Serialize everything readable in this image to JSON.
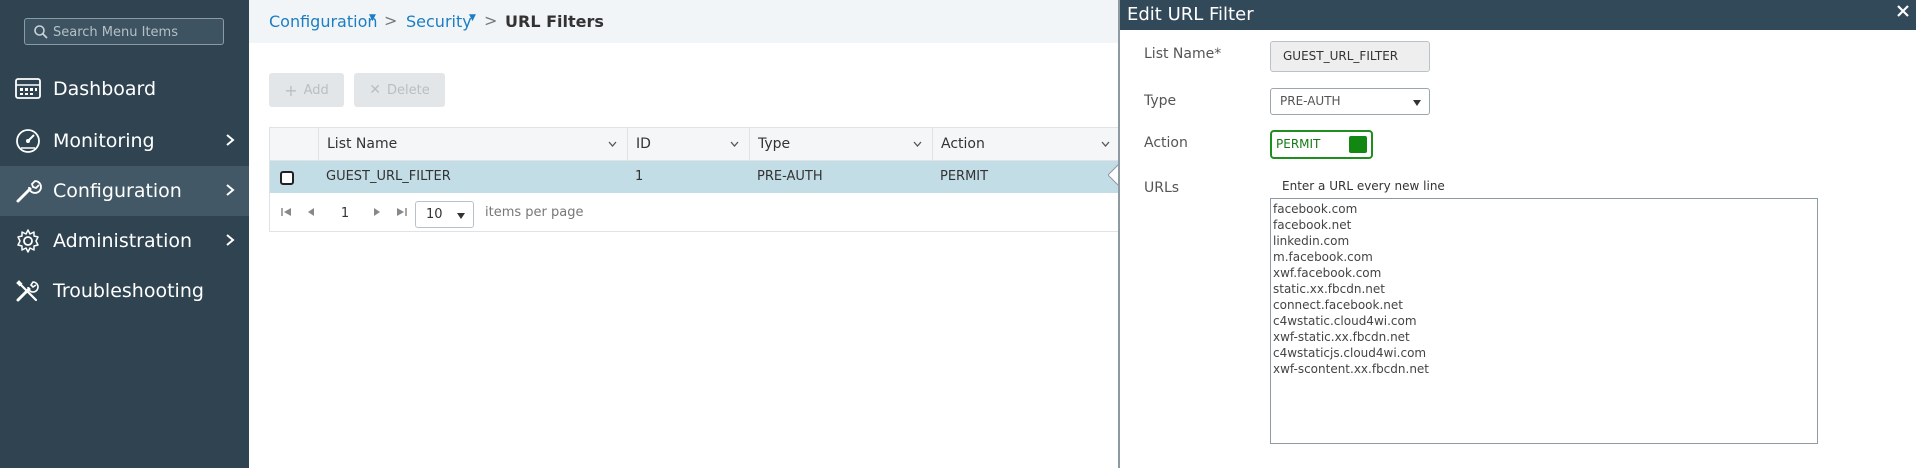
{
  "sidebar": {
    "search_placeholder": "Search Menu Items",
    "items": [
      {
        "label": "Dashboard",
        "icon": "dashboard-icon",
        "has_chevron": false,
        "active": false
      },
      {
        "label": "Monitoring",
        "icon": "monitoring-icon",
        "has_chevron": true,
        "active": false
      },
      {
        "label": "Configuration",
        "icon": "configuration-icon",
        "has_chevron": true,
        "active": true
      },
      {
        "label": "Administration",
        "icon": "administration-icon",
        "has_chevron": true,
        "active": false
      },
      {
        "label": "Troubleshooting",
        "icon": "troubleshooting-icon",
        "has_chevron": false,
        "active": false
      }
    ]
  },
  "breadcrumb": {
    "items": [
      "Configuration",
      "Security"
    ],
    "current": "URL Filters"
  },
  "toolbar": {
    "add_label": "Add",
    "delete_label": "Delete"
  },
  "grid": {
    "columns": [
      "List Name",
      "ID",
      "Type",
      "Action"
    ],
    "rows": [
      {
        "list_name": "GUEST_URL_FILTER",
        "id": "1",
        "type": "PRE-AUTH",
        "action": "PERMIT"
      }
    ],
    "pager": {
      "page": "1",
      "page_size": "10",
      "per_page_label": "items per page"
    }
  },
  "panel": {
    "title": "Edit URL Filter",
    "list_name_label": "List Name*",
    "list_name_value": "GUEST_URL_FILTER",
    "type_label": "Type",
    "type_value": "PRE-AUTH",
    "action_label": "Action",
    "action_value": "PERMIT",
    "urls_label": "URLs",
    "urls_hint": "Enter a URL every new line",
    "urls": [
      "facebook.com",
      "facebook.net",
      "linkedin.com",
      "m.facebook.com",
      "xwf.facebook.com",
      "static.xx.fbcdn.net",
      "connect.facebook.net",
      "c4wstatic.cloud4wi.com",
      "xwf-static.xx.fbcdn.net",
      "c4wstaticjs.cloud4wi.com",
      "xwf-scontent.xx.fbcdn.net"
    ]
  },
  "colors": {
    "sidebar_bg": "#2f4351",
    "sidebar_active": "#435866",
    "link": "#1b7ec2",
    "panel_header": "#32495a",
    "selected_row": "#c3dde7",
    "toggle_green": "#128812"
  }
}
